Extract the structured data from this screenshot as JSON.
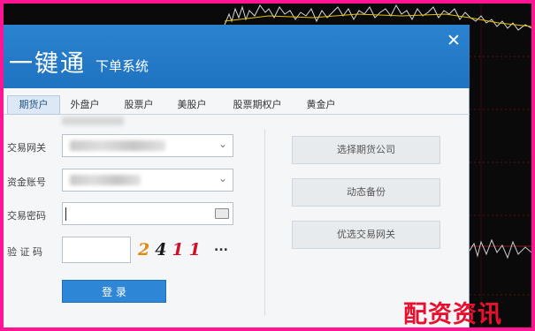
{
  "window": {
    "title": "一键通",
    "subtitle": "下单系统",
    "close_glyph": "✕"
  },
  "tabs": [
    {
      "label": "期货户",
      "active": true
    },
    {
      "label": "外盘户",
      "active": false
    },
    {
      "label": "股票户",
      "active": false
    },
    {
      "label": "美股户",
      "active": false
    },
    {
      "label": "股票期权户",
      "active": false
    },
    {
      "label": "黄金户",
      "active": false
    }
  ],
  "form": {
    "trading_gateway_label": "交易网关",
    "account_label": "资金账号",
    "password_label": "交易密码",
    "captcha_label": "验 证 码",
    "captcha_code": [
      "2",
      "4",
      "1",
      "1"
    ],
    "captcha_refresh": "...",
    "login_button": "登 录"
  },
  "side_buttons": [
    {
      "label": "选择期货公司"
    },
    {
      "label": "动态备份"
    },
    {
      "label": "优选交易网关"
    }
  ],
  "watermark": "配资资讯",
  "colors": {
    "frame": "#ff1493",
    "titlebar": "#2b83cf",
    "captcha": [
      "#e08a10",
      "#1a1a1a",
      "#d0102a",
      "#d0102a"
    ],
    "watermark": "#e8102e"
  }
}
